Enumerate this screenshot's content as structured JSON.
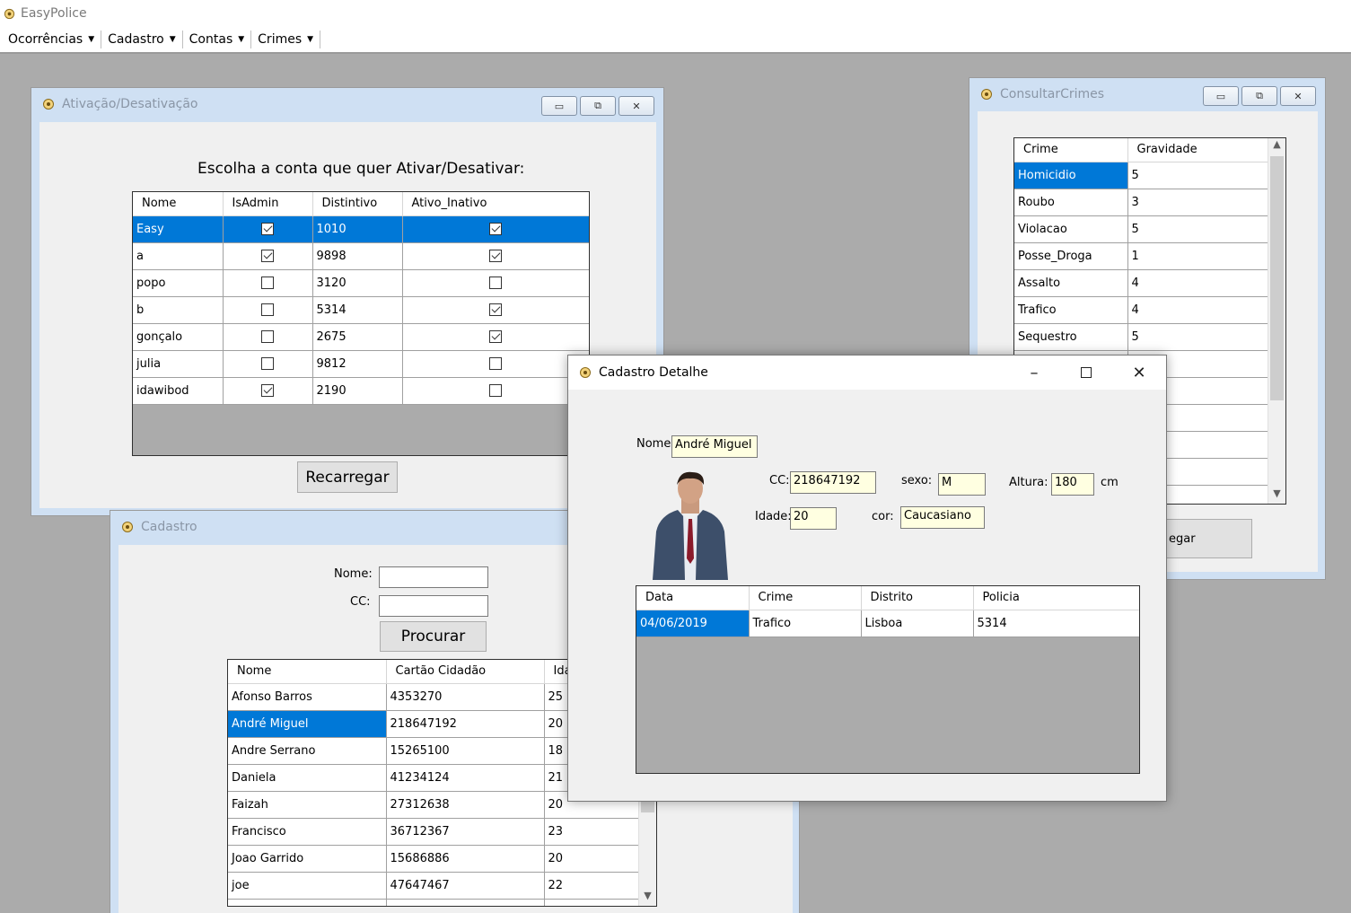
{
  "app": {
    "title": "EasyPolice"
  },
  "menu": [
    "Ocorrências",
    "Cadastro",
    "Contas",
    "Crimes"
  ],
  "ativacao": {
    "title": "Ativação/Desativação",
    "heading": "Escolha a conta que quer Ativar/Desativar:",
    "columns": [
      "Nome",
      "IsAdmin",
      "Distintivo",
      "Ativo_Inativo"
    ],
    "rows": [
      {
        "nome": "Easy",
        "admin": true,
        "distintivo": "1010",
        "ativo": true
      },
      {
        "nome": "a",
        "admin": true,
        "distintivo": "9898",
        "ativo": true
      },
      {
        "nome": "popo",
        "admin": false,
        "distintivo": "3120",
        "ativo": false
      },
      {
        "nome": "b",
        "admin": false,
        "distintivo": "5314",
        "ativo": true
      },
      {
        "nome": "gonçalo",
        "admin": false,
        "distintivo": "2675",
        "ativo": true
      },
      {
        "nome": "julia",
        "admin": false,
        "distintivo": "9812",
        "ativo": false
      },
      {
        "nome": "idawibod",
        "admin": true,
        "distintivo": "2190",
        "ativo": false
      }
    ],
    "reload_label": "Recarregar"
  },
  "consultar": {
    "title": "ConsultarCrimes",
    "columns": [
      "Crime",
      "Gravidade"
    ],
    "rows": [
      [
        "Homicidio",
        "5"
      ],
      [
        "Roubo",
        "3"
      ],
      [
        "Violacao",
        "5"
      ],
      [
        "Posse_Droga",
        "1"
      ],
      [
        "Assalto",
        "4"
      ],
      [
        "Trafico",
        "4"
      ],
      [
        "Sequestro",
        "5"
      ]
    ],
    "reload_label_partial": "egar"
  },
  "cadastro": {
    "title": "Cadastro",
    "nome_label": "Nome:",
    "cc_label": "CC:",
    "nome_value": "",
    "cc_value": "",
    "search_label": "Procurar",
    "columns": [
      "Nome",
      "Cartão Cidadão",
      "Ida"
    ],
    "rows": [
      [
        "Afonso Barros",
        "4353270",
        "25"
      ],
      [
        "André Miguel",
        "218647192",
        "20"
      ],
      [
        "Andre Serrano",
        "15265100",
        "18"
      ],
      [
        "Daniela",
        "41234124",
        "21"
      ],
      [
        "Faizah",
        "27312638",
        "20"
      ],
      [
        "Francisco",
        "36712367",
        "23"
      ],
      [
        "Joao Garrido",
        "15686886",
        "20"
      ],
      [
        "joe",
        "47647467",
        "22"
      ]
    ]
  },
  "detalhe": {
    "title": "Cadastro Detalhe",
    "nome_label": "Nome:",
    "nome_value": "André Miguel",
    "cc_label": "CC:",
    "cc_value": "218647192",
    "sexo_label": "sexo:",
    "sexo_value": "M",
    "altura_label": "Altura:",
    "altura_value": "180",
    "altura_unit": "cm",
    "idade_label": "Idade:",
    "idade_value": "20",
    "cor_label": "cor:",
    "cor_value": "Caucasiano",
    "columns": [
      "Data",
      "Crime",
      "Distrito",
      "Policia"
    ],
    "rows": [
      [
        "04/06/2019",
        "Trafico",
        "Lisboa",
        "5314"
      ]
    ]
  },
  "colors": {
    "selection": "#0078d7",
    "mdi_background": "#ababab",
    "input_yellow": "#ffffe1"
  }
}
